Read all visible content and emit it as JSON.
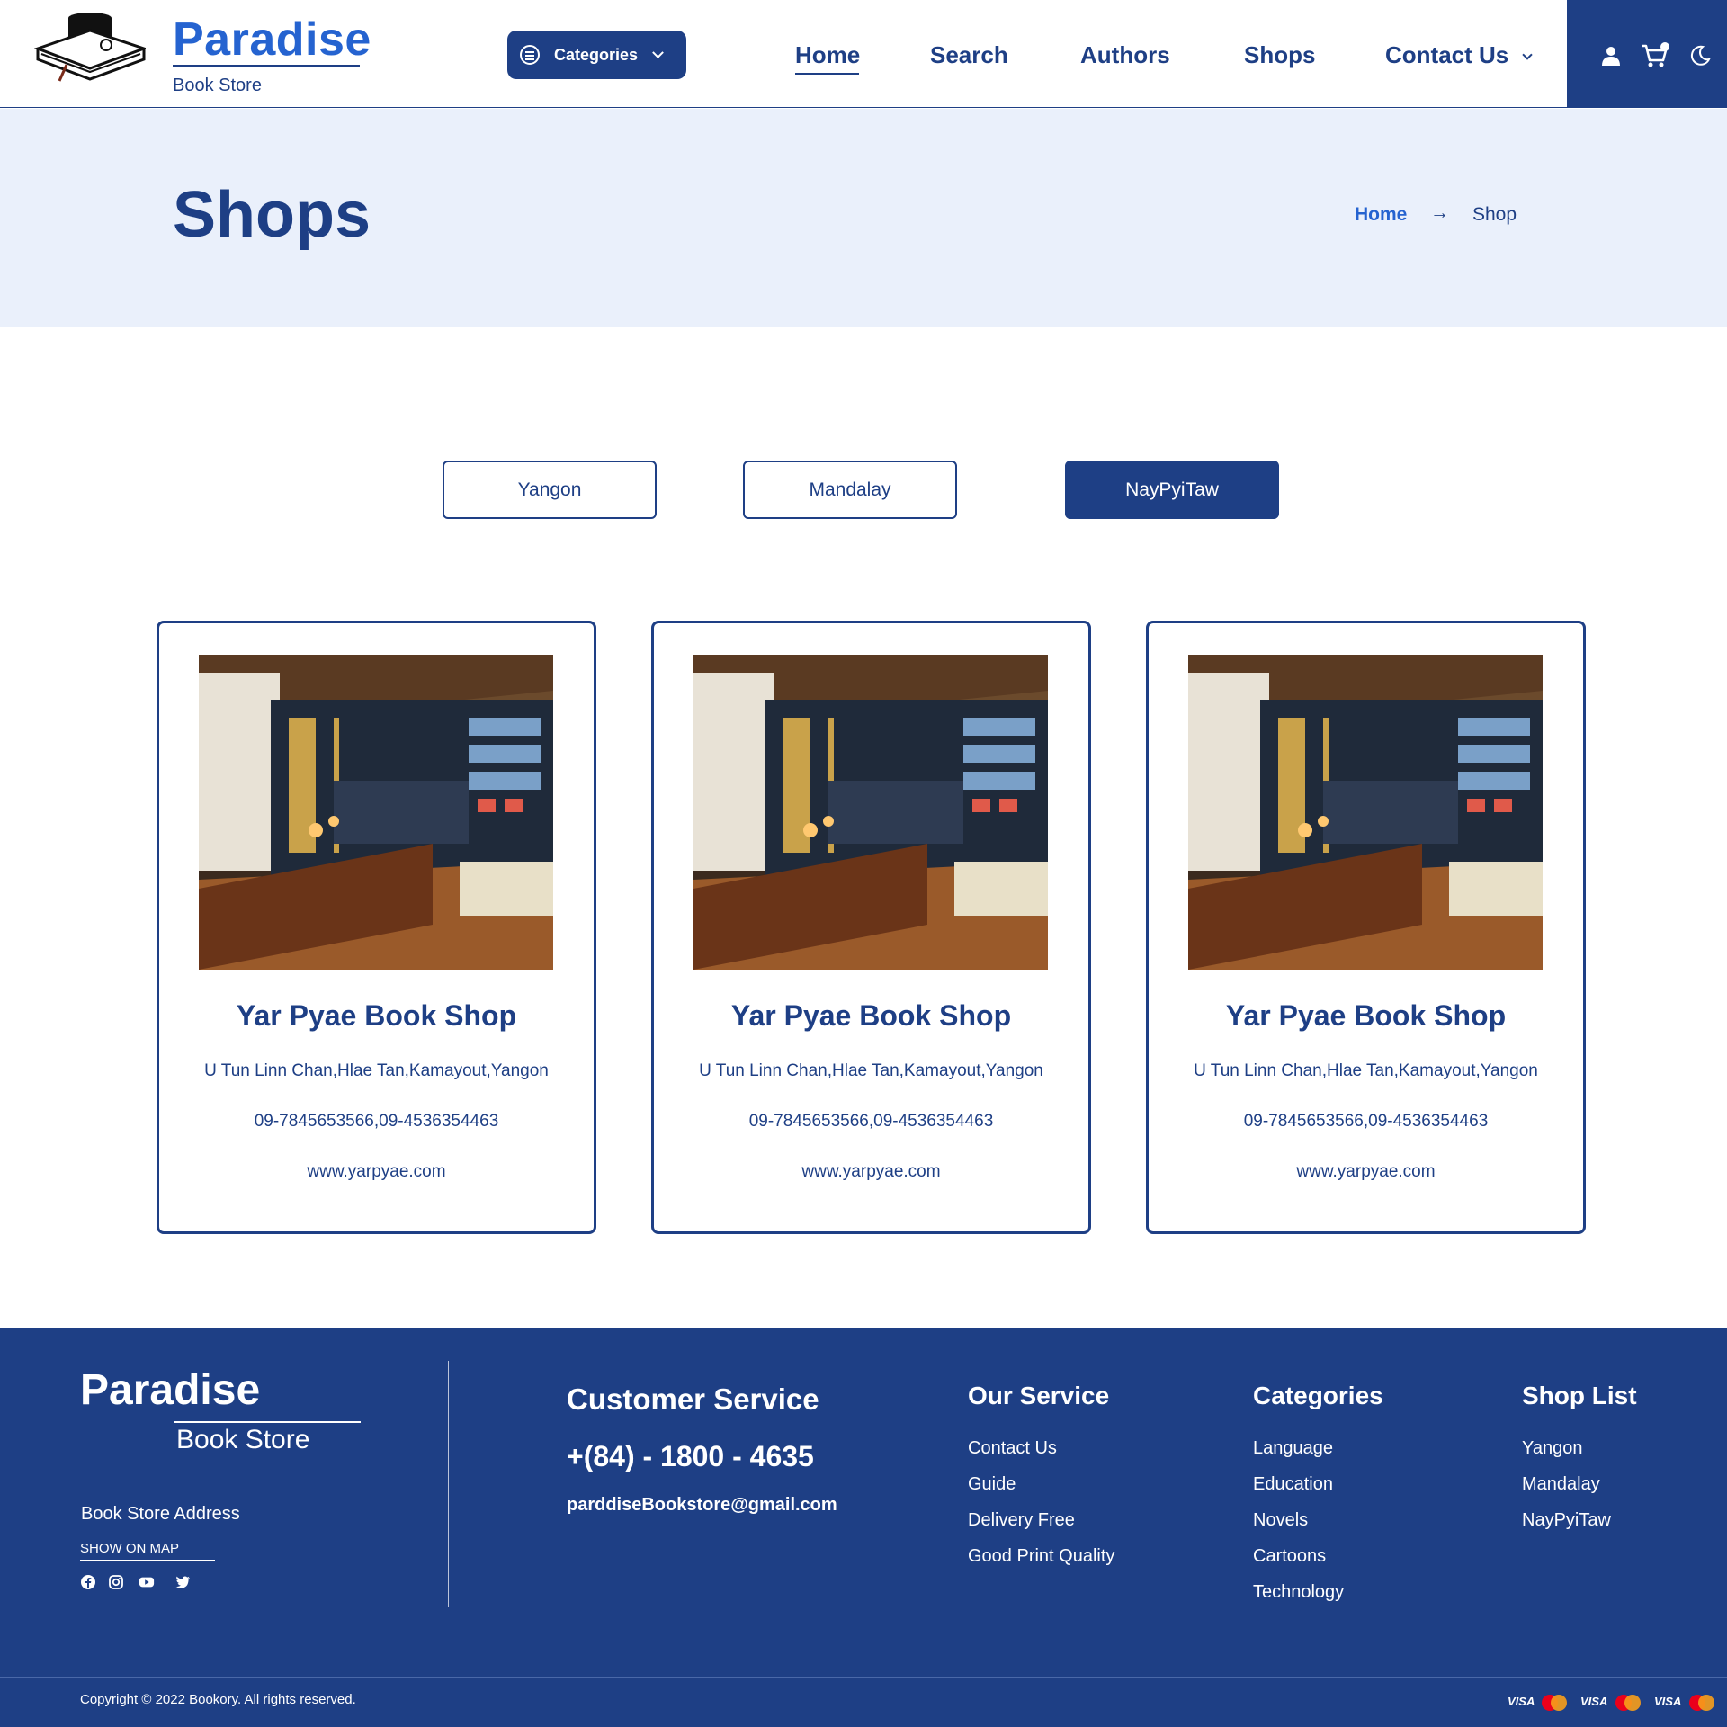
{
  "header": {
    "brand_name": "Paradise",
    "brand_sub": "Book Store",
    "categories_label": "Categories",
    "nav": {
      "home": "Home",
      "search": "Search",
      "authors": "Authors",
      "shops": "Shops",
      "contact": "Contact Us"
    },
    "active_nav": "Home"
  },
  "hero": {
    "title": "Shops",
    "breadcrumb": {
      "home": "Home",
      "separator": "→",
      "current": "Shop"
    }
  },
  "city_tabs": {
    "yangon": "Yangon",
    "mandalay": "Mandalay",
    "naypyitaw": "NayPyiTaw",
    "active": "NayPyiTaw"
  },
  "shops": [
    {
      "name": "Yar Pyae Book Shop",
      "address": "U Tun Linn Chan,Hlae Tan,Kamayout,Yangon",
      "phone": "09-7845653566,09-4536354463",
      "website": "www.yarpyae.com"
    },
    {
      "name": "Yar Pyae Book Shop",
      "address": "U Tun Linn Chan,Hlae Tan,Kamayout,Yangon",
      "phone": "09-7845653566,09-4536354463",
      "website": "www.yarpyae.com"
    },
    {
      "name": "Yar Pyae Book Shop",
      "address": "U Tun Linn Chan,Hlae Tan,Kamayout,Yangon",
      "phone": "09-7845653566,09-4536354463",
      "website": "www.yarpyae.com"
    }
  ],
  "footer": {
    "brand_name": "Paradise",
    "brand_sub": "Book Store",
    "address_label": "Book Store Address",
    "map_link": "SHOW ON MAP",
    "social_icons": [
      "facebook-icon",
      "instagram-icon",
      "youtube-icon",
      "twitter-icon"
    ],
    "customer_service": {
      "title": "Customer Service",
      "phone": "+(84) - 1800 - 4635",
      "email": "parddiseBookstore@gmail.com"
    },
    "our_service": {
      "title": "Our Service",
      "items": [
        "Contact Us",
        "Guide",
        "Delivery Free",
        "Good Print Quality"
      ]
    },
    "categories": {
      "title": "Categories",
      "items": [
        "Language",
        "Education",
        "Novels",
        "Cartoons",
        "Technology"
      ]
    },
    "shop_list": {
      "title": "Shop List",
      "items": [
        "Yangon",
        "Mandalay",
        "NayPyiTaw"
      ]
    },
    "copyright": "Copyright © 2022 Bookory. All rights reserved.",
    "payments": [
      "VISA",
      "MasterCard",
      "VISA",
      "MasterCard",
      "VISA",
      "MasterCard"
    ]
  },
  "colors": {
    "primary": "#1e3f85",
    "accent": "#2563d0",
    "hero_bg": "#eaf0fb"
  }
}
